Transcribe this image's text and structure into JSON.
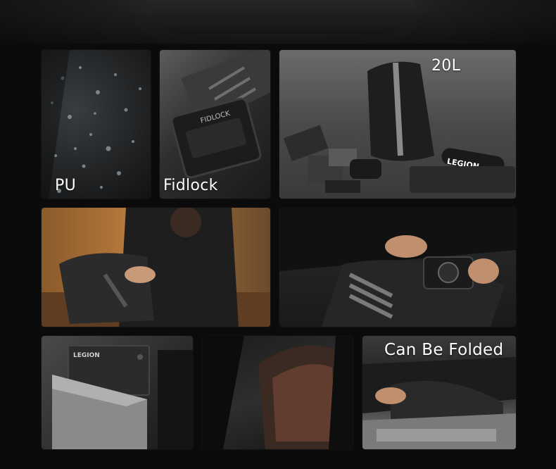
{
  "captions": {
    "pu": "PU",
    "fidlock": "Fidlock",
    "capacity": "20L",
    "folded": "Can Be Folded"
  },
  "product_marks": {
    "fidlock_buckle": "FIDLOCK",
    "legion_umbrella": "LEGION",
    "legion_tablet": "LEGION"
  },
  "colors": {
    "background": "#0b0b0b",
    "caption_text": "#ffffff",
    "reflective_stripe": "#8a8a8a"
  }
}
